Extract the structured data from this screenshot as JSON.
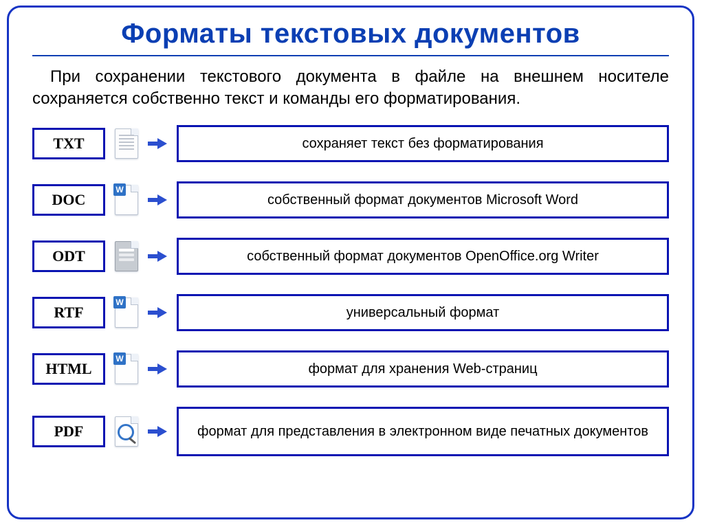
{
  "title": "Форматы текстовых документов",
  "intro": "При сохранении текстового документа в файле на внешнем носителе сохраняется собственно текст и команды его форматирования.",
  "formats": {
    "txt": {
      "label": "TXT",
      "desc": "сохраняет текст без форматирования"
    },
    "doc": {
      "label": "DOC",
      "desc": "собственный формат документов Microsoft Word"
    },
    "odt": {
      "label": "ODT",
      "desc": "собственный формат документов OpenOffice.org Writer"
    },
    "rtf": {
      "label": "RTF",
      "desc": "универсальный формат"
    },
    "html": {
      "label": "HTML",
      "desc": "формат для хранения Web-страниц"
    },
    "pdf": {
      "label": "PDF",
      "desc": "формат для представления в электронном виде печатных документов"
    }
  }
}
